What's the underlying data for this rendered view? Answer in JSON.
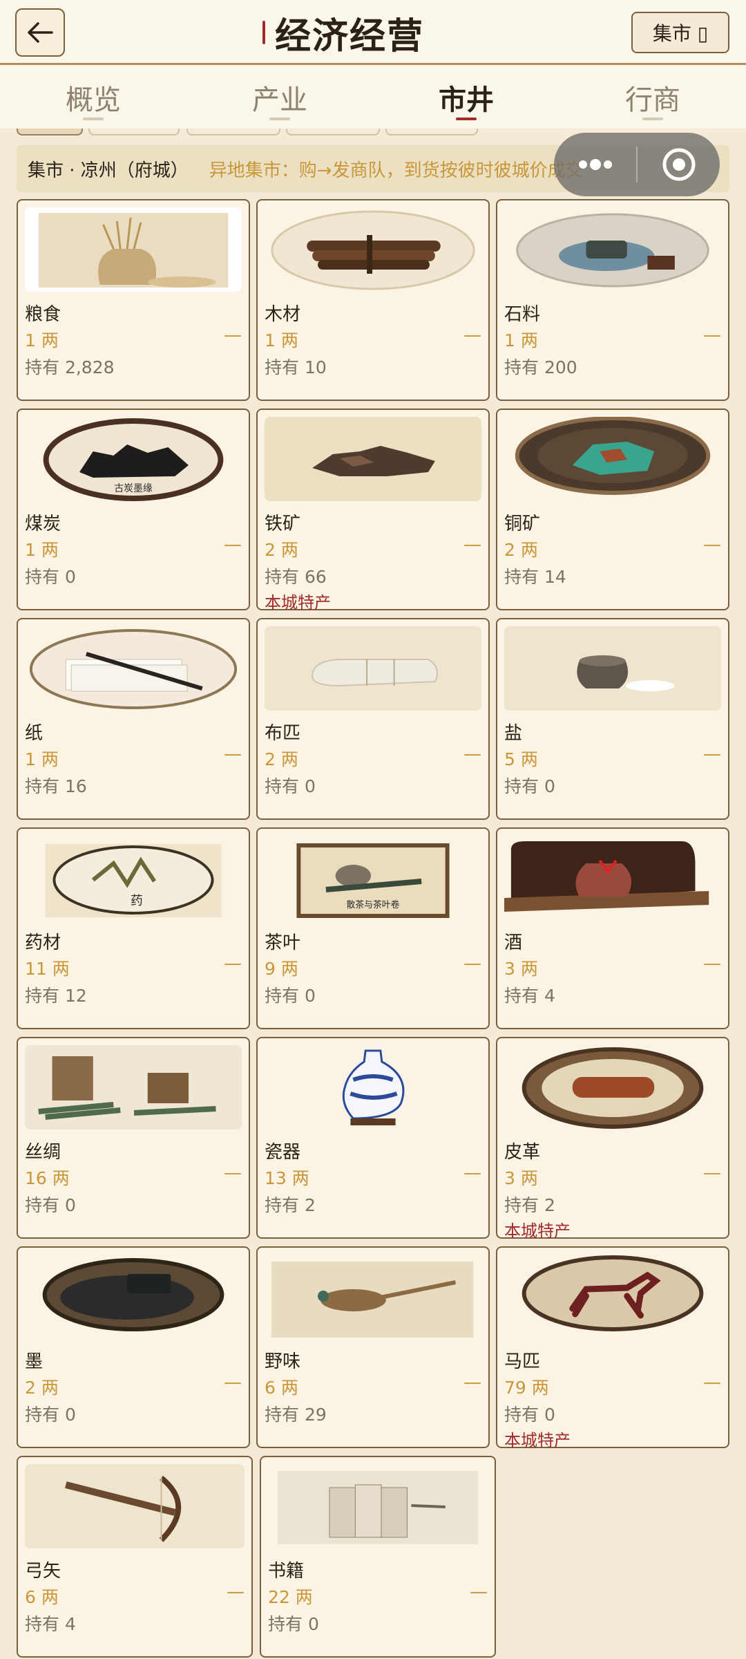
{
  "header": {
    "title": "经济经营",
    "market_button": "集市 ▯"
  },
  "tabs": [
    {
      "label": "概览",
      "active": false
    },
    {
      "label": "产业",
      "active": false
    },
    {
      "label": "市井",
      "active": true
    },
    {
      "label": "行商",
      "active": false
    }
  ],
  "infobar": {
    "city": "集市 · 凉州（府城）",
    "note": "异地集市：购→发商队，到货按彼时彼城价成交"
  },
  "items": [
    {
      "name": "粮食",
      "price": "1 两",
      "trend": "—",
      "held": "持有 2,828",
      "special": "",
      "icon": "grain-sack-icon"
    },
    {
      "name": "木材",
      "price": "1 两",
      "trend": "—",
      "held": "持有 10",
      "special": "",
      "icon": "timber-icon"
    },
    {
      "name": "石料",
      "price": "1 两",
      "trend": "—",
      "held": "持有 200",
      "special": "",
      "icon": "stone-icon"
    },
    {
      "name": "煤炭",
      "price": "1 两",
      "trend": "—",
      "held": "持有 0",
      "special": "",
      "icon": "coal-icon"
    },
    {
      "name": "铁矿",
      "price": "2 两",
      "trend": "—",
      "held": "持有 66",
      "special": "本城特产",
      "icon": "iron-ore-icon"
    },
    {
      "name": "铜矿",
      "price": "2 两",
      "trend": "—",
      "held": "持有 14",
      "special": "",
      "icon": "copper-ore-icon"
    },
    {
      "name": "纸",
      "price": "1 两",
      "trend": "—",
      "held": "持有 16",
      "special": "",
      "icon": "paper-icon"
    },
    {
      "name": "布匹",
      "price": "2 两",
      "trend": "—",
      "held": "持有 0",
      "special": "",
      "icon": "cloth-icon"
    },
    {
      "name": "盐",
      "price": "5 两",
      "trend": "—",
      "held": "持有 0",
      "special": "",
      "icon": "salt-jar-icon"
    },
    {
      "name": "药材",
      "price": "11 两",
      "trend": "—",
      "held": "持有 12",
      "special": "",
      "icon": "herbs-icon"
    },
    {
      "name": "茶叶",
      "price": "9 两",
      "trend": "—",
      "held": "持有 0",
      "special": "",
      "icon": "tea-icon"
    },
    {
      "name": "酒",
      "price": "3 两",
      "trend": "—",
      "held": "持有 4",
      "special": "",
      "icon": "wine-jar-icon"
    },
    {
      "name": "丝绸",
      "price": "16 两",
      "trend": "—",
      "held": "持有 0",
      "special": "",
      "icon": "silk-scroll-icon"
    },
    {
      "name": "瓷器",
      "price": "13 两",
      "trend": "—",
      "held": "持有 2",
      "special": "",
      "icon": "porcelain-vase-icon"
    },
    {
      "name": "皮革",
      "price": "3 两",
      "trend": "—",
      "held": "持有 2",
      "special": "本城特产",
      "icon": "leather-icon"
    },
    {
      "name": "墨",
      "price": "2 两",
      "trend": "—",
      "held": "持有 0",
      "special": "",
      "icon": "ink-stone-icon"
    },
    {
      "name": "野味",
      "price": "6 两",
      "trend": "—",
      "held": "持有 29",
      "special": "",
      "icon": "pheasant-icon"
    },
    {
      "name": "马匹",
      "price": "79 两",
      "trend": "—",
      "held": "持有 0",
      "special": "本城特产",
      "icon": "horse-icon"
    },
    {
      "name": "弓矢",
      "price": "6 两",
      "trend": "—",
      "held": "持有 4",
      "special": "",
      "icon": "bow-arrow-icon"
    },
    {
      "name": "书籍",
      "price": "22 两",
      "trend": "—",
      "held": "持有 0",
      "special": "",
      "icon": "books-icon"
    }
  ],
  "colors": {
    "price_gold": "#c9973a",
    "special_red": "#a12c2c",
    "border_brown": "#7a5f3f",
    "background": "#f4ead6"
  }
}
